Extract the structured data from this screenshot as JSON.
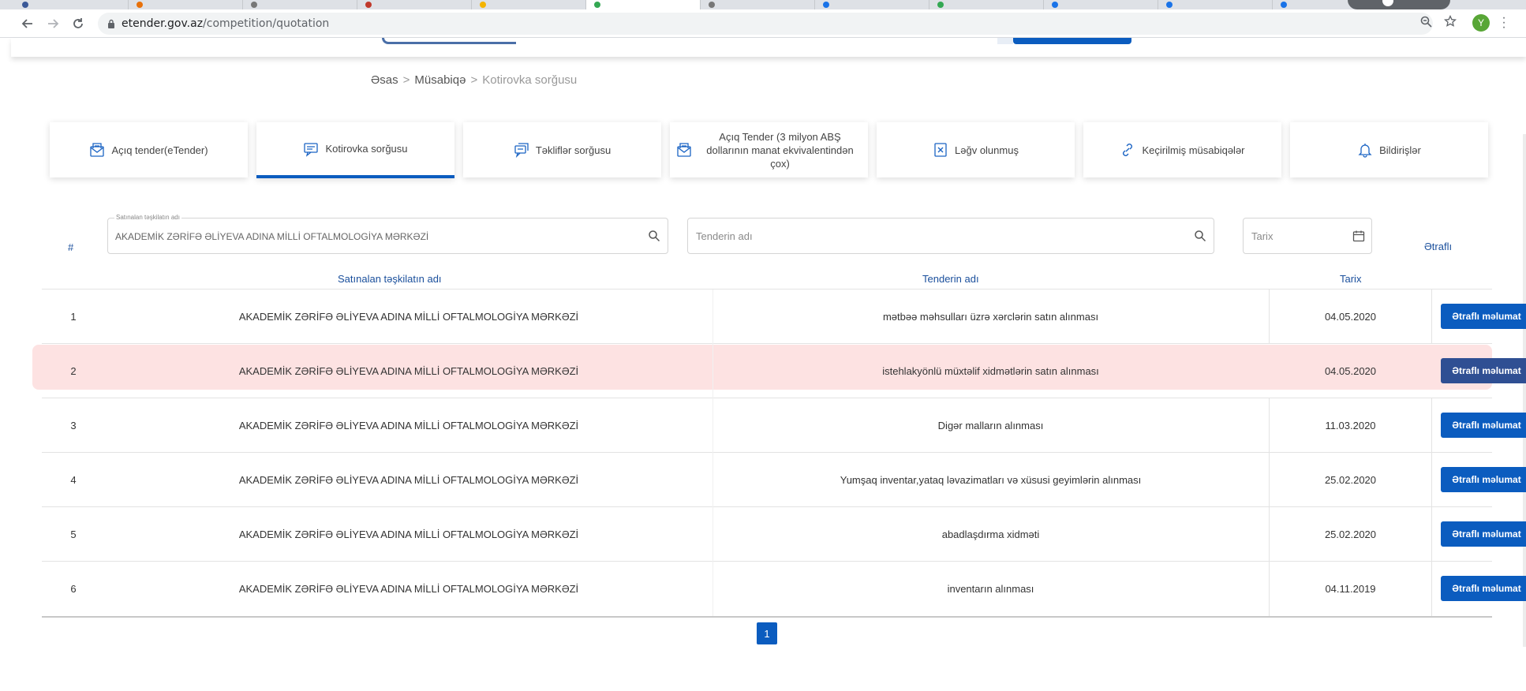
{
  "browser": {
    "url_host": "etender.gov.az",
    "url_path": "/competition/quotation",
    "avatar_letter": "Y",
    "icons": [
      "back-icon",
      "forward-icon",
      "reload-icon",
      "lock-icon",
      "zoom-icon",
      "star-icon",
      "menu-icon"
    ]
  },
  "breadcrumb": {
    "home": "Əsas",
    "section": "Müsabiqə",
    "current": "Kotirovka sorğusu",
    "separator": ">"
  },
  "category_tabs": [
    {
      "label": "Açıq tender(eTender)",
      "icon": "envelope-icon"
    },
    {
      "label": "Kotirovka sorğusu",
      "icon": "message-icon",
      "active": true
    },
    {
      "label": "Təkliflər sorğusu",
      "icon": "chat-icon"
    },
    {
      "label": "Açıq Tender (3 milyon ABŞ dollarının manat ekvivalentindən çox)",
      "icon": "envelope-icon"
    },
    {
      "label": "Ləğv olunmuş",
      "icon": "cancel-icon"
    },
    {
      "label": "Keçirilmiş müsabiqələr",
      "icon": "link-icon"
    },
    {
      "label": "Bildirişlər",
      "icon": "bell-icon"
    }
  ],
  "filters": {
    "hash": "#",
    "org_label": "Satınalan təşkilatın adı",
    "org_value": "AKADEMİK ZƏRİFƏ ƏLİYEVA ADINA MİLLİ OFTALMOLOGİYA MƏRKƏZİ",
    "tender_placeholder": "Tenderin adı",
    "date_placeholder": "Tarix",
    "more": "Ətraflı"
  },
  "columns": {
    "org": "Satınalan təşkilatın adı",
    "name": "Tenderin adı",
    "date": "Tarix"
  },
  "rows": [
    {
      "num": "1",
      "org": "AKADEMİK ZƏRİFƏ ƏLİYEVA ADINA MİLLİ OFTALMOLOGİYA MƏRKƏZİ",
      "name": "mətbəə məhsulları üzrə xərclərin satın alınması",
      "date": "04.05.2020",
      "button": "Ətraflı məlumat"
    },
    {
      "num": "2",
      "org": "AKADEMİK ZƏRİFƏ ƏLİYEVA ADINA MİLLİ OFTALMOLOGİYA MƏRKƏZİ",
      "name": "istehlakyönlü müxtəlif xidmətlərin satın alınması",
      "date": "04.05.2020",
      "button": "Ətraflı məlumat",
      "highlighted": true
    },
    {
      "num": "3",
      "org": "AKADEMİK ZƏRİFƏ ƏLİYEVA ADINA MİLLİ OFTALMOLOGİYA MƏRKƏZİ",
      "name": "Digər malların alınması",
      "date": "11.03.2020",
      "button": "Ətraflı məlumat"
    },
    {
      "num": "4",
      "org": "AKADEMİK ZƏRİFƏ ƏLİYEVA ADINA MİLLİ OFTALMOLOGİYA MƏRKƏZİ",
      "name": "Yumşaq inventar,yataq ləvazimatları və xüsusi geyimlərin alınması",
      "date": "25.02.2020",
      "button": "Ətraflı məlumat"
    },
    {
      "num": "5",
      "org": "AKADEMİK ZƏRİFƏ ƏLİYEVA ADINA MİLLİ OFTALMOLOGİYA MƏRKƏZİ",
      "name": "abadlaşdırma xidməti",
      "date": "25.02.2020",
      "button": "Ətraflı məlumat"
    },
    {
      "num": "6",
      "org": "AKADEMİK ZƏRİFƏ ƏLİYEVA ADINA MİLLİ OFTALMOLOGİYA MƏRKƏZİ",
      "name": "inventarın alınması",
      "date": "04.11.2019",
      "button": "Ətraflı məlumat"
    }
  ],
  "pagination": {
    "current": "1"
  },
  "colors": {
    "primary": "#0b5cbf",
    "heading": "#1a4f9c",
    "highlight_row": "#fde2e2",
    "highlight_button": "#2f4f93"
  }
}
